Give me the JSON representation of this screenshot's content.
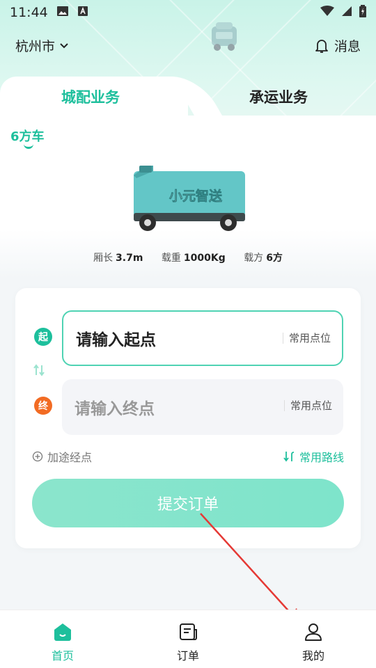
{
  "status_bar": {
    "time": "11:44"
  },
  "header": {
    "city": "杭州市",
    "messages_label": "消息"
  },
  "tabs": [
    {
      "label": "城配业务",
      "active": true
    },
    {
      "label": "承运业务",
      "active": false
    }
  ],
  "vehicle": {
    "type": "6方车",
    "brand_text": "小元智送",
    "specs": [
      {
        "label": "厢长",
        "value": "3.7m"
      },
      {
        "label": "载重",
        "value": "1000Kg"
      },
      {
        "label": "载方",
        "value": "6方"
      }
    ]
  },
  "form": {
    "start_badge": "起",
    "end_badge": "终",
    "start_placeholder": "请输入起点",
    "end_placeholder": "请输入终点",
    "common_points_label": "常用点位",
    "add_waypoint_label": "加途经点",
    "common_routes_label": "常用路线",
    "submit_label": "提交订单"
  },
  "bottom_nav": [
    {
      "label": "首页",
      "icon": "home-icon",
      "active": true
    },
    {
      "label": "订单",
      "icon": "order-icon",
      "active": false
    },
    {
      "label": "我的",
      "icon": "profile-icon",
      "active": false
    }
  ],
  "colors": {
    "accent": "#1dbf9c",
    "end_marker": "#f26b23",
    "annotation_arrow": "#e53935"
  }
}
